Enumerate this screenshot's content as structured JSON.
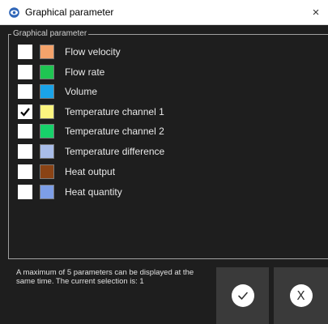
{
  "window": {
    "title": "Graphical parameter",
    "close_glyph": "×",
    "icon": "eye-icon"
  },
  "group": {
    "legend": "Graphical parameter"
  },
  "parameters": [
    {
      "label": "Flow velocity",
      "color": "#f4a36b",
      "checked": false
    },
    {
      "label": "Flow rate",
      "color": "#1fc552",
      "checked": false
    },
    {
      "label": "Volume",
      "color": "#1aa3e8",
      "checked": false
    },
    {
      "label": "Temperature channel 1",
      "color": "#fcf57f",
      "checked": true
    },
    {
      "label": "Temperature channel 2",
      "color": "#17d16a",
      "checked": false
    },
    {
      "label": "Temperature difference",
      "color": "#a9bde9",
      "checked": false
    },
    {
      "label": "Heat output",
      "color": "#8a4315",
      "checked": false
    },
    {
      "label": "Heat quantity",
      "color": "#7d9ee6",
      "checked": false
    }
  ],
  "info": {
    "text": "A maximum of 5 parameters can be displayed at the same time. The current selection is: 1"
  },
  "buttons": {
    "ok_icon": "checkmark-icon",
    "cancel_glyph": "X"
  },
  "colors": {
    "background": "#1e1e1e",
    "button_bg": "#3a3a3a"
  }
}
